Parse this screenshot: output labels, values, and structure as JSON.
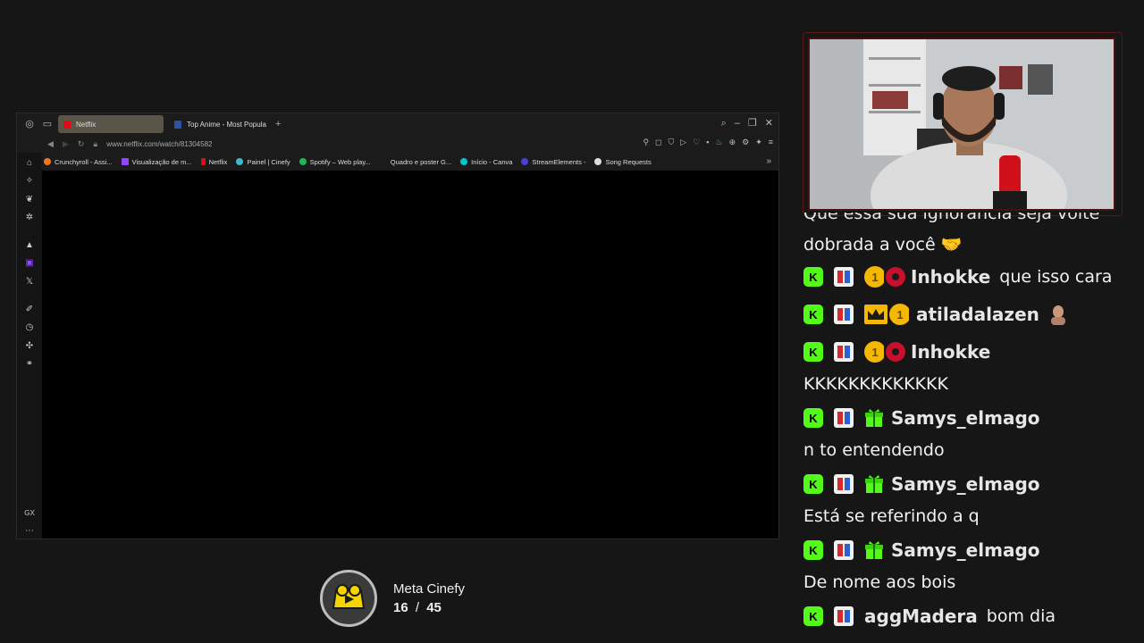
{
  "browser": {
    "tabs": [
      {
        "label": "Netflix",
        "active": true,
        "color": "#e50914"
      },
      {
        "label": "Top Anime - Most Popula",
        "active": false,
        "color": "#2e51a2"
      }
    ],
    "url": "www.netflix.com/watch/81304582",
    "bookmarks": [
      {
        "label": "Crunchyroll - Assi...",
        "color": "#f47521"
      },
      {
        "label": "Visualização de m...",
        "color": "#9146ff"
      },
      {
        "label": "Netflix",
        "color": "#e50914"
      },
      {
        "label": "Painel | Cinefy",
        "color": "#3fb8c9"
      },
      {
        "label": "Spotify – Web play...",
        "color": "#1db954"
      },
      {
        "label": "Quadro e poster G...",
        "color": "#222222"
      },
      {
        "label": "Início - Canva",
        "color": "#00c4cc"
      },
      {
        "label": "StreamElements -",
        "color": "#4a3fd6"
      },
      {
        "label": "Song Requests",
        "color": "#dddddd"
      }
    ]
  },
  "chat": {
    "partial_top": "Que essa sua ignorância seja volte",
    "messages": [
      {
        "type": "text",
        "text": "dobrada a você 🤝"
      },
      {
        "type": "user",
        "username": "Inhokke",
        "text": "que isso cara",
        "badges": [
          "kick",
          "avatar",
          "gold",
          "red"
        ]
      },
      {
        "type": "user",
        "username": "atiladalazen",
        "text": "",
        "badges": [
          "kick",
          "avatar",
          "crown",
          "gold"
        ]
      },
      {
        "type": "user",
        "username": "Inhokke",
        "text": "",
        "badges": [
          "kick",
          "avatar",
          "gold",
          "red"
        ]
      },
      {
        "type": "text",
        "text": "KKKKKKKKKKKKK"
      },
      {
        "type": "user",
        "username": "Samys_elmago",
        "text": "",
        "badges": [
          "kick",
          "avatar",
          "gift"
        ]
      },
      {
        "type": "text",
        "text": "n to entendendo"
      },
      {
        "type": "user",
        "username": "Samys_elmago",
        "text": "",
        "badges": [
          "kick",
          "avatar",
          "gift"
        ]
      },
      {
        "type": "text",
        "text": "Está se referindo a q"
      },
      {
        "type": "user",
        "username": "Samys_elmago",
        "text": "",
        "badges": [
          "kick",
          "avatar",
          "gift"
        ]
      },
      {
        "type": "text",
        "text": "De nome aos bois"
      },
      {
        "type": "user",
        "username": "aggMadera",
        "text": "bom dia",
        "badges": [
          "kick",
          "avatar"
        ]
      }
    ]
  },
  "meta": {
    "title": "Meta Cinefy",
    "current": "16",
    "separator": "/",
    "total": "45",
    "progress_fraction": 0.356
  },
  "colors": {
    "kick_green": "#53fc18",
    "gold": "#f5b800",
    "gift_green": "#53fc18",
    "background": "#161616"
  }
}
